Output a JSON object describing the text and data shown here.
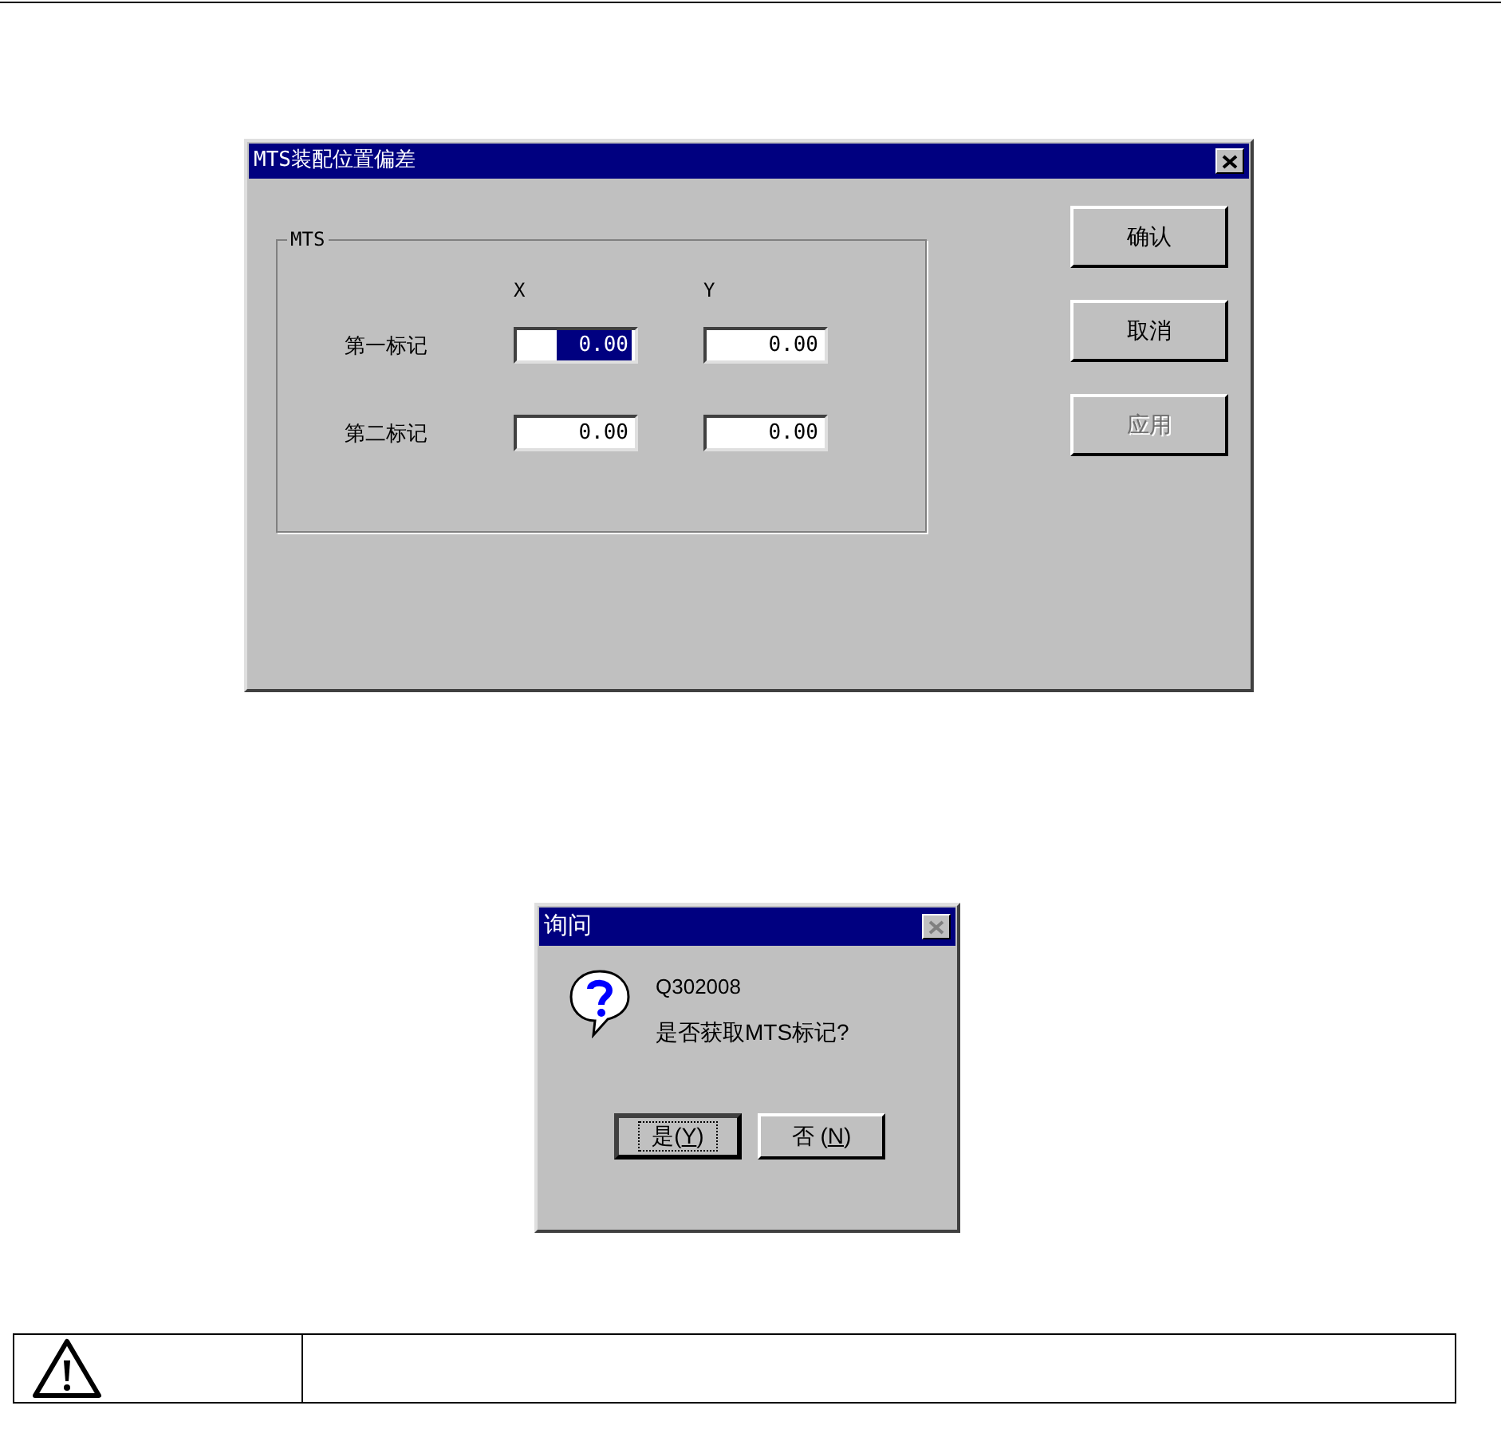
{
  "offset_dialog": {
    "title": "MTS装配位置偏差",
    "close_disabled": false,
    "group": {
      "title": "MTS",
      "columns": [
        "X",
        "Y"
      ],
      "rows": [
        {
          "label": "第一标记",
          "fields": [
            {
              "value": "0.00",
              "selected": true
            },
            {
              "value": "0.00",
              "selected": false
            }
          ]
        },
        {
          "label": "第二标记",
          "fields": [
            {
              "value": "0.00",
              "selected": false
            },
            {
              "value": "0.00",
              "selected": false
            }
          ]
        }
      ]
    },
    "buttons": [
      {
        "label": "确认",
        "disabled": false
      },
      {
        "label": "取消",
        "disabled": false
      },
      {
        "label": "应用",
        "disabled": true
      }
    ]
  },
  "query_dialog": {
    "title": "询问",
    "close_disabled": true,
    "code": "Q302008",
    "message": "是否获取MTS标记?",
    "buttons": [
      {
        "before": "是(",
        "mnemonic": "Y",
        "after": ")",
        "default": true
      },
      {
        "before": "否 (",
        "mnemonic": "N",
        "after": ")",
        "default": false
      }
    ]
  }
}
